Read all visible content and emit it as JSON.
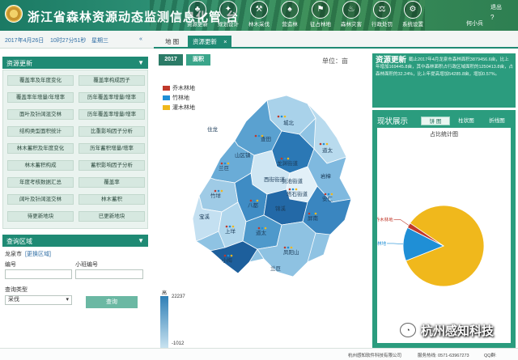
{
  "header": {
    "title": "浙江省森林资源动态监测信息化管 台",
    "nav": [
      {
        "label": "资源更新",
        "icon": "tree-icon"
      },
      {
        "label": "规划设计",
        "icon": "compass-icon"
      },
      {
        "label": "林木采伐",
        "icon": "axe-icon"
      },
      {
        "label": "营造林",
        "icon": "sapling-icon"
      },
      {
        "label": "征占林地",
        "icon": "flag-icon"
      },
      {
        "label": "森林灾害",
        "icon": "fire-icon"
      },
      {
        "label": "行政处罚",
        "icon": "gavel-icon"
      },
      {
        "label": "系统设置",
        "icon": "gear-icon"
      }
    ],
    "logout": "退出",
    "help": "?",
    "user": "何小兵"
  },
  "datebar": {
    "date": "2017年4月26日",
    "time": "10时27分51秒",
    "weekday": "星期三"
  },
  "resource_panel": {
    "title": "资源更新",
    "buttons": [
      "覆盖率及年度变化",
      "覆盖率构成因子",
      "覆盖率年增量/年增率",
      "历年覆盖率增量/增率",
      "面叶及针阔混交林",
      "历年覆盖率增量/增率",
      "结构类型面积统计",
      "比重影响因子分析",
      "林木蓄积及年度变化",
      "历年蓄积增量/增率",
      "林木蓄积构成",
      "蓄积影响因子分析",
      "年度考核数据汇总",
      "覆盖率",
      "阔叶及针阔混交林",
      "林木蓄积",
      "待更新地块",
      "已更新地块"
    ]
  },
  "query_panel": {
    "title": "查询区域",
    "city": "龙泉市",
    "switch_link": "[更换区域]",
    "field1_label": "编号",
    "field2_label": "小班编号",
    "type_label": "查询类型",
    "type_value": "采伐",
    "query_button": "查询"
  },
  "tabs": [
    {
      "label": "地 图",
      "active": false
    },
    {
      "label": "资源更新",
      "active": true,
      "close": "×"
    }
  ],
  "map": {
    "year": "2017",
    "metric": "面积",
    "unit": "单位：亩",
    "legend": [
      {
        "label": "乔木林地",
        "color": "#c0392b"
      },
      {
        "label": "竹林地",
        "color": "#1f8fd6"
      },
      {
        "label": "灌木林地",
        "color": "#f0b81c"
      }
    ],
    "scale_top": "高",
    "scale_max": "22237",
    "scale_min": "-1012",
    "scale_bottom": "低",
    "regions": [
      "城北",
      "道太",
      "山区镇",
      "查田",
      "兰巨",
      "龙渊街道",
      "剑池街道",
      "西街街道",
      "竹垟",
      "塔石街道",
      "安仁",
      "宝溪",
      "八都",
      "屏南",
      "上垟",
      "小梅",
      "道太",
      "凤阳山",
      "岩樟",
      "锦溪",
      "兰巨"
    ],
    "labels_overlay": [
      "住龙"
    ]
  },
  "info": {
    "title": "资源更新",
    "text": "截止2017年4月龙泉市森林面积3879456.6亩，比上年增加169445.8亩，其中森林面积占行政区域面积的1250413.8亩，占森林面积的32.24%，比上年提高增加54285.8亩，增加0.57%。"
  },
  "stats": {
    "title": "现状展示",
    "tabs": [
      {
        "label": "饼 图",
        "active": true
      },
      {
        "label": "柱状图",
        "active": false
      },
      {
        "label": "折线图",
        "active": false
      }
    ]
  },
  "chart_data": {
    "type": "pie",
    "title": "占比统计图",
    "slices": [
      {
        "name": "灌木林地",
        "value": 84.5,
        "color": "#f0b81c"
      },
      {
        "name": "竹林地",
        "value": 13.5,
        "color": "#1f8fd6"
      },
      {
        "name": "乔木林地",
        "value": 2.0,
        "color": "#c0392b"
      }
    ]
  },
  "footer": {
    "company": "杭州感知软件科技有限公司",
    "hotline": "服务热线: 0571-63967273",
    "qq": "QQ群:",
    "watermark": "杭州感知科技"
  }
}
